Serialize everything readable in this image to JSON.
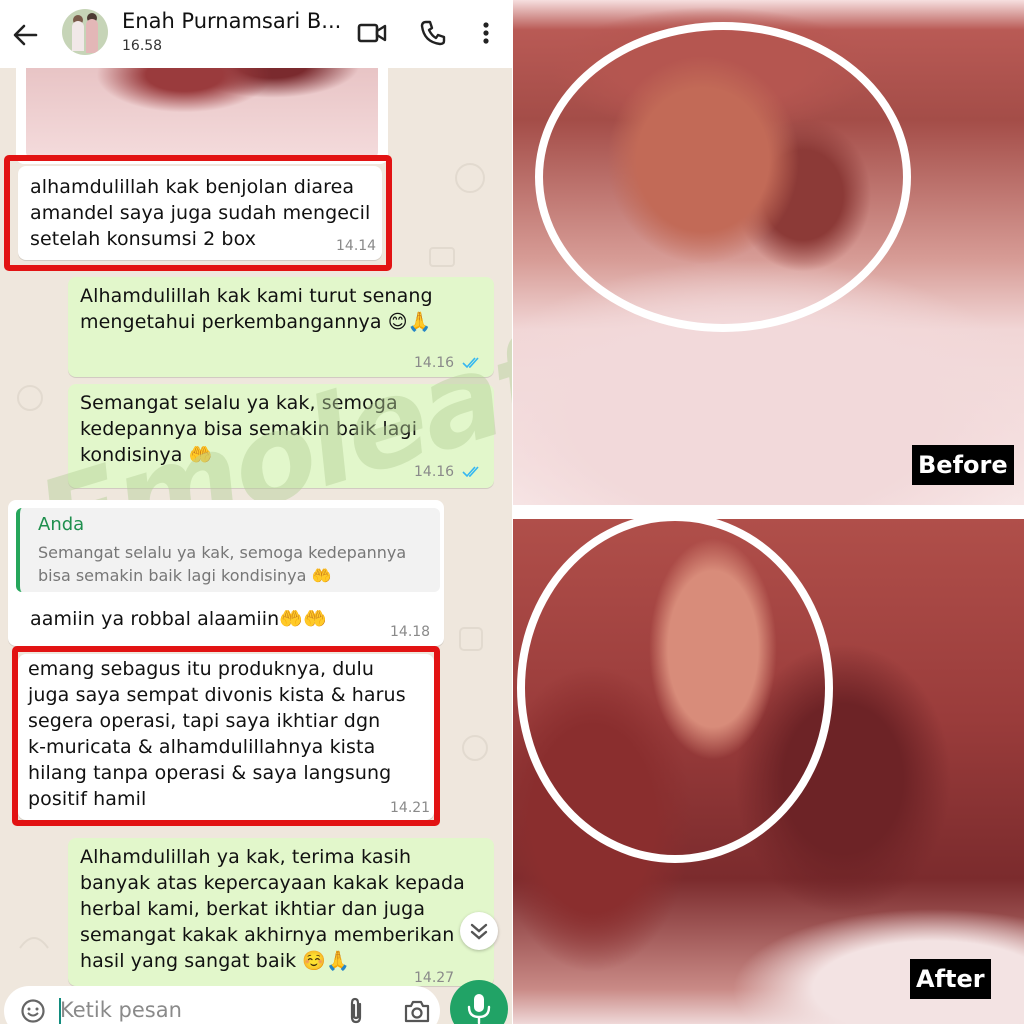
{
  "header": {
    "contact_name": "Enah Purnamsari B...",
    "status": "16.58"
  },
  "messages": [
    {
      "id": "m1",
      "direction": "incoming",
      "text": "alhamdulillah kak benjolan diarea\namandel saya juga sudah mengecil\nsetelah konsumsi 2 box",
      "time": "14.14",
      "highlighted": true
    },
    {
      "id": "m2",
      "direction": "outgoing",
      "text": "Alhamdulillah kak kami turut senang\nmengetahui perkembangannya 😊🙏",
      "time": "14.16",
      "read": true
    },
    {
      "id": "m3",
      "direction": "outgoing",
      "text": "Semangat selalu ya kak, semoga\nkedepannya bisa semakin baik lagi\nkondisinya 🤲",
      "time": "14.16",
      "read": true
    },
    {
      "id": "m4",
      "direction": "incoming",
      "quote_sender": "Anda",
      "quote_text": "Semangat selalu ya kak, semoga kedepannya\nbisa semakin baik lagi kondisinya 🤲",
      "text": "aamiin ya robbal alaamiin🤲🤲",
      "time": "14.18"
    },
    {
      "id": "m5",
      "direction": "incoming",
      "text": "emang sebagus itu produknya, dulu\njuga saya sempat divonis kista & harus\nsegera operasi, tapi saya ikhtiar dgn\nk-muricata & alhamdulillahnya kista\nhilang tanpa operasi & saya langsung\npositif hamil",
      "time": "14.21",
      "highlighted": true
    },
    {
      "id": "m6",
      "direction": "outgoing",
      "text": "Alhamdulillah ya kak, terima kasih\nbanyak atas kepercayaan kakak kepada\nherbal kami, berkat ikhtiar dan juga\nsemangat kakak akhirnya memberikan\nhasil yang sangat baik ☺️🙏",
      "time": "14.27",
      "read": true
    }
  ],
  "watermark": "Emoleaf",
  "input": {
    "placeholder": "Ketik pesan"
  },
  "photos": {
    "before_label": "Before",
    "after_label": "After"
  },
  "colors": {
    "highlight": "#e21313",
    "outgoing_bubble": "#e2f7cb",
    "incoming_bubble": "#ffffff",
    "mic_button": "#21a366",
    "read_ticks": "#34b7f1",
    "chat_background": "#efe7dd"
  },
  "icons": [
    "back-arrow-icon",
    "video-call-icon",
    "phone-icon",
    "more-vert-icon",
    "emoji-icon",
    "attach-icon",
    "camera-icon",
    "mic-icon",
    "chevron-double-down-icon"
  ]
}
